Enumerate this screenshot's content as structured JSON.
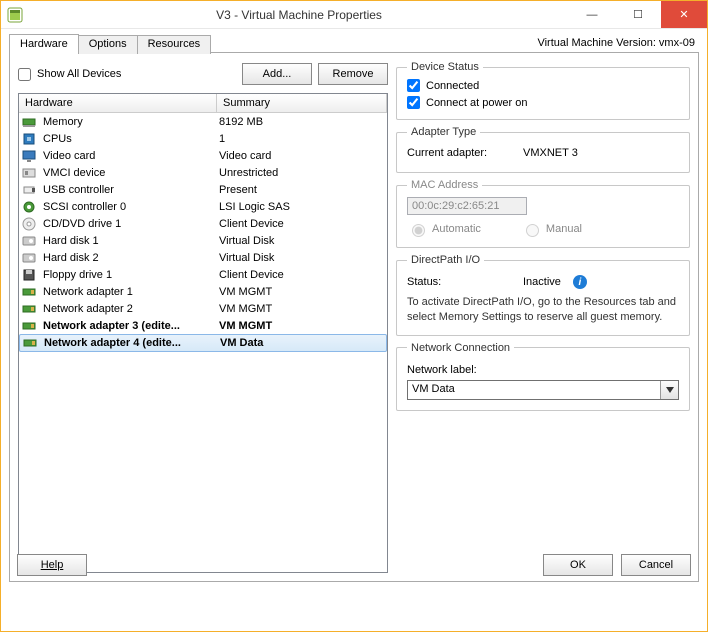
{
  "window": {
    "title": "V3 - Virtual Machine Properties",
    "vm_version": "Virtual Machine Version: vmx-09"
  },
  "tabs": {
    "hardware": "Hardware",
    "options": "Options",
    "resources": "Resources"
  },
  "controls": {
    "show_all": "Show All Devices",
    "add": "Add...",
    "remove": "Remove",
    "help": "Help",
    "ok": "OK",
    "cancel": "Cancel"
  },
  "columns": {
    "hardware": "Hardware",
    "summary": "Summary"
  },
  "rows": [
    {
      "name": "Memory",
      "summary": "8192 MB",
      "icon": "memory"
    },
    {
      "name": "CPUs",
      "summary": "1",
      "icon": "cpu"
    },
    {
      "name": "Video card",
      "summary": "Video card",
      "icon": "display"
    },
    {
      "name": "VMCI device",
      "summary": "Unrestricted",
      "icon": "pci"
    },
    {
      "name": "USB controller",
      "summary": "Present",
      "icon": "usb"
    },
    {
      "name": "SCSI controller 0",
      "summary": "LSI Logic SAS",
      "icon": "scsi"
    },
    {
      "name": "CD/DVD drive 1",
      "summary": "Client Device",
      "icon": "cd"
    },
    {
      "name": "Hard disk 1",
      "summary": "Virtual Disk",
      "icon": "hdd"
    },
    {
      "name": "Hard disk 2",
      "summary": "Virtual Disk",
      "icon": "hdd"
    },
    {
      "name": "Floppy drive 1",
      "summary": "Client Device",
      "icon": "floppy"
    },
    {
      "name": "Network adapter 1",
      "summary": "VM MGMT",
      "icon": "nic"
    },
    {
      "name": "Network adapter 2",
      "summary": "VM MGMT",
      "icon": "nic"
    },
    {
      "name": "Network adapter 3 (edite...",
      "summary": "VM MGMT",
      "icon": "nic",
      "bold": true
    },
    {
      "name": "Network adapter 4 (edite...",
      "summary": "VM Data",
      "icon": "nic",
      "bold": true,
      "selected": true
    }
  ],
  "device_status": {
    "legend": "Device Status",
    "connected": "Connected",
    "connected_checked": true,
    "power_on": "Connect at power on",
    "power_on_checked": true
  },
  "adapter_type": {
    "legend": "Adapter Type",
    "label": "Current adapter:",
    "value": "VMXNET 3"
  },
  "mac": {
    "legend": "MAC Address",
    "value": "00:0c:29:c2:65:21",
    "auto": "Automatic",
    "manual": "Manual"
  },
  "directpath": {
    "legend": "DirectPath I/O",
    "status_label": "Status:",
    "status_value": "Inactive",
    "hint": "To activate DirectPath I/O, go to the Resources tab and select Memory Settings to reserve all guest memory."
  },
  "netconn": {
    "legend": "Network Connection",
    "label": "Network label:",
    "value": "VM Data"
  }
}
